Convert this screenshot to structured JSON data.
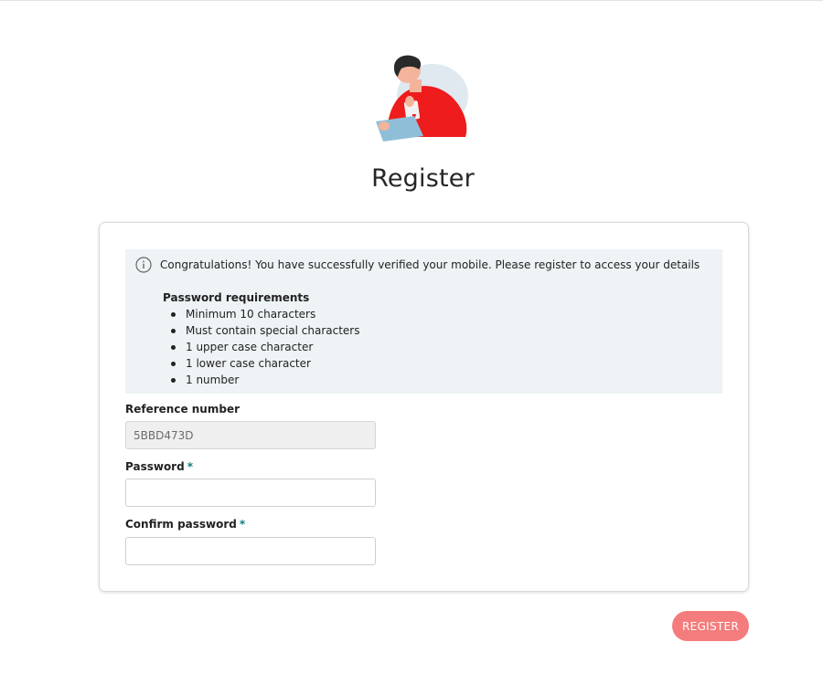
{
  "page": {
    "title": "Register"
  },
  "notice": {
    "message": "Congratulations! You have successfully verified your mobile. Please register to access your details"
  },
  "password_requirements": {
    "title": "Password requirements",
    "items": [
      "Minimum 10 characters",
      "Must contain special characters",
      "1 upper case character",
      "1 lower case character",
      "1 number"
    ]
  },
  "form": {
    "reference": {
      "label": "Reference number",
      "value": "5BBD473D"
    },
    "password": {
      "label": "Password",
      "required_mark": "*",
      "value": ""
    },
    "confirm_password": {
      "label": "Confirm password",
      "required_mark": "*",
      "value": ""
    }
  },
  "actions": {
    "register_label": "REGISTER"
  },
  "colors": {
    "accent_red": "#ee1c1c",
    "register_button": "#f47c7c",
    "required_star": "#0f7c7c",
    "info_background": "#eef3f6"
  },
  "icons": {
    "hero": "person-with-tablet-illustration",
    "info": "info-circle-icon"
  }
}
